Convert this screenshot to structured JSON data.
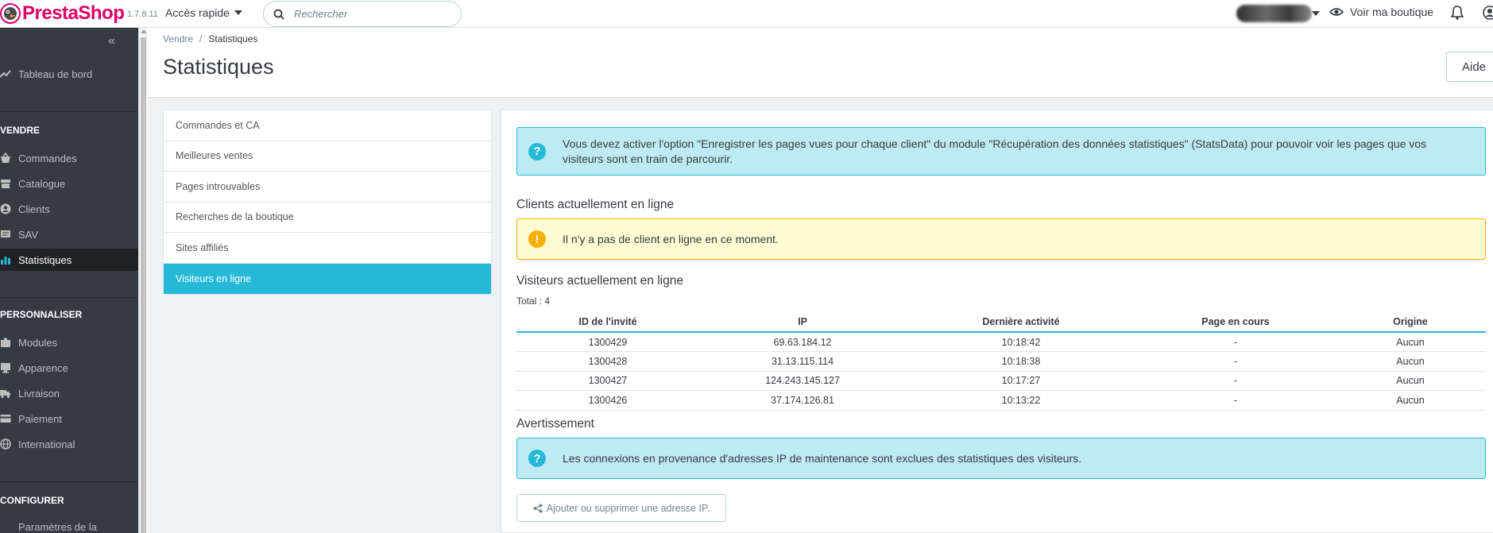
{
  "topbar": {
    "brand": "PrestaShop",
    "version": "1.7.8.11",
    "quick_access": "Accès rapide",
    "search_placeholder": "Rechercher",
    "view_shop": "Voir ma boutique"
  },
  "sidebar": {
    "dashboard": "Tableau de bord",
    "section_sell": "VENDRE",
    "sell_items": [
      "Commandes",
      "Catalogue",
      "Clients",
      "SAV",
      "Statistiques"
    ],
    "section_customize": "PERSONNALISER",
    "customize_items": [
      "Modules",
      "Apparence",
      "Livraison",
      "Paiement",
      "International"
    ],
    "section_configure": "CONFIGURER",
    "configure_items": [
      "Paramètres de la"
    ]
  },
  "header": {
    "breadcrumb_parent": "Vendre",
    "breadcrumb_current": "Statistiques",
    "title": "Statistiques",
    "help": "Aide"
  },
  "stats_menu": [
    "Commandes et CA",
    "Meilleures ventes",
    "Pages introuvables",
    "Recherches de la boutique",
    "Sites affiliés",
    "Visiteurs en ligne"
  ],
  "main": {
    "info_alert": "Vous devez activer l'option \"Enregistrer les pages vues pour chaque client\" du module \"Récupération des données statistiques\" (StatsData) pour pouvoir voir les pages que vos visiteurs sont en train de parcourir.",
    "customers_title": "Clients actuellement en ligne",
    "no_customer": "Il n'y a pas de client en ligne en ce moment.",
    "visitors_title": "Visiteurs actuellement en ligne",
    "total": "Total : 4",
    "columns": [
      "ID de l'invité",
      "IP",
      "Dernière activité",
      "Page en cours",
      "Origine"
    ],
    "rows": [
      [
        "1300429",
        "69.63.184.12",
        "10:18:42",
        "-",
        "Aucun"
      ],
      [
        "1300428",
        "31.13.115.114",
        "10:18:38",
        "-",
        "Aucun"
      ],
      [
        "1300427",
        "124.243.145.127",
        "10:17:27",
        "-",
        "Aucun"
      ],
      [
        "1300426",
        "37.174.126.81",
        "10:13:22",
        "-",
        "Aucun"
      ]
    ],
    "warning_title": "Avertissement",
    "maintenance_info": "Les connexions en provenance d'adresses IP de maintenance sont exclues des statistiques des visiteurs.",
    "ip_button": "Ajouter ou supprimer une adresse IP."
  },
  "colors": {
    "accent": "#25b9d7",
    "brand": "#df0067",
    "sidebar_bg": "#363a41",
    "warning": "#fab000"
  }
}
